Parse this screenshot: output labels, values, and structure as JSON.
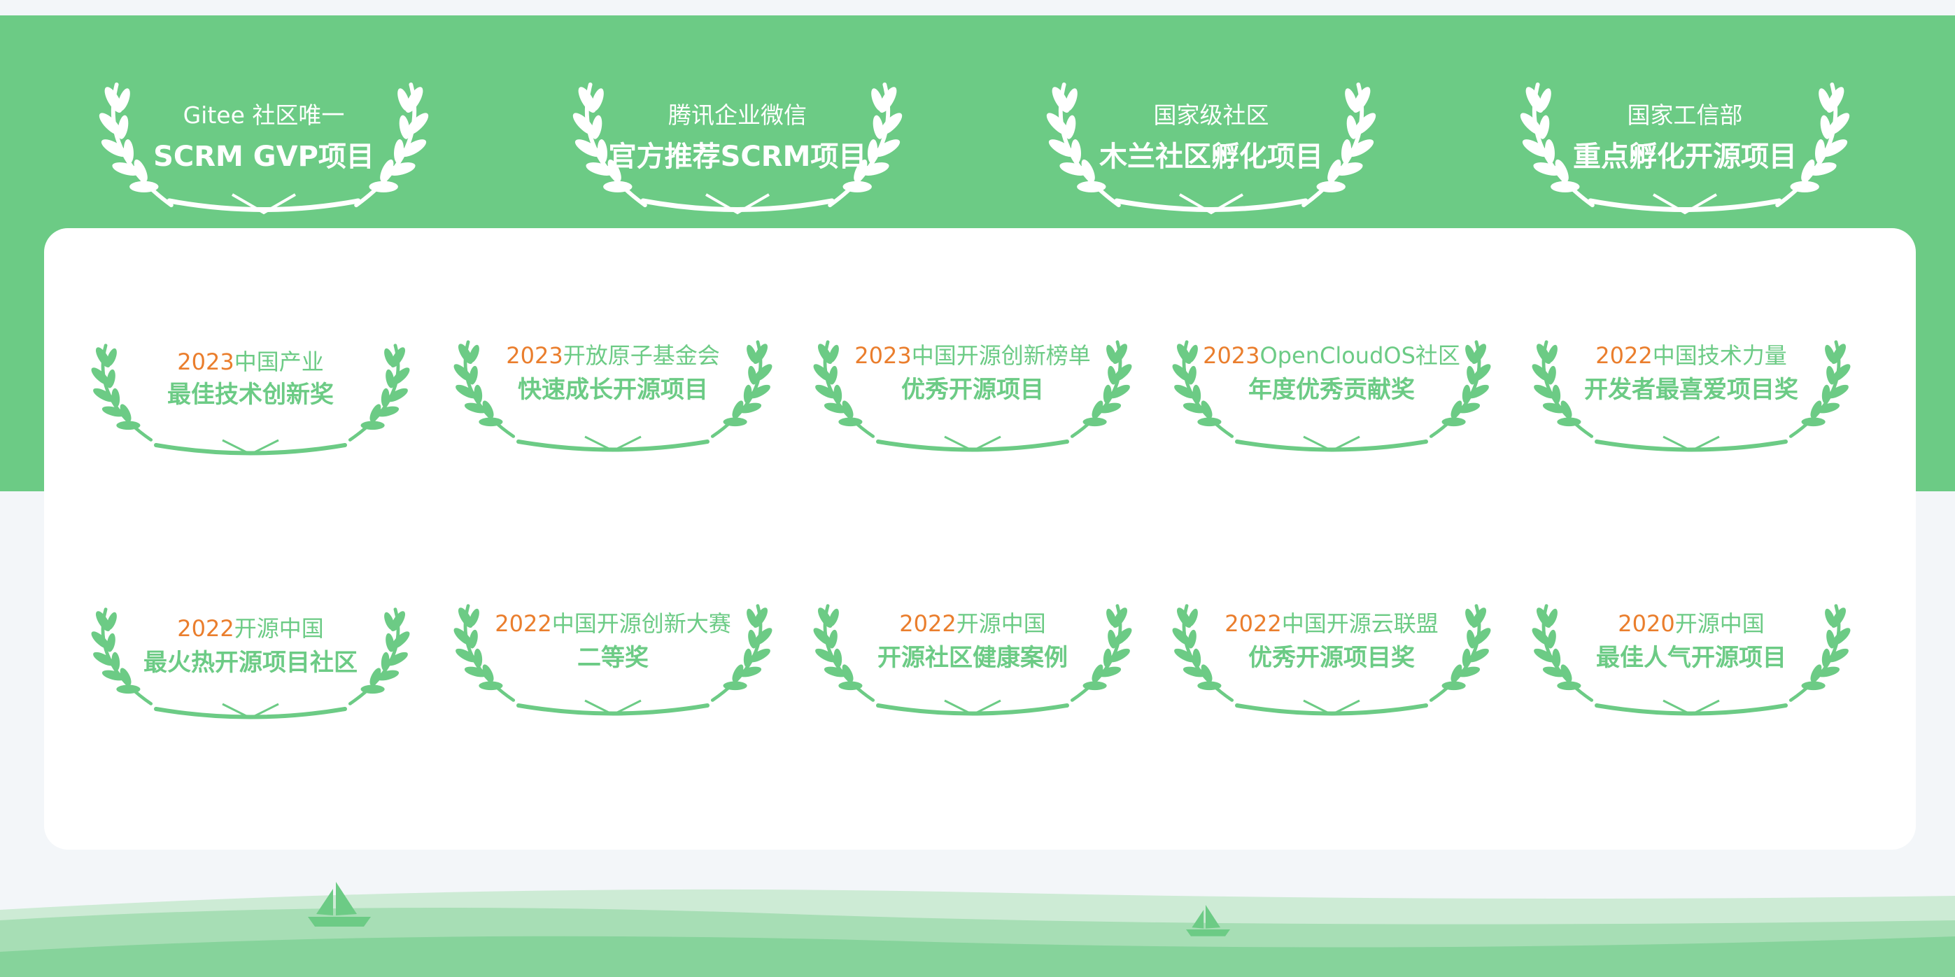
{
  "colors": {
    "green": "#6ccb85",
    "orange": "#ea7e2d",
    "white": "#ffffff",
    "page_bg": "#f3f6f9"
  },
  "icons": {
    "wreath": "laurel-wreath-icon",
    "boat": "sailboat-icon"
  },
  "hero_awards": [
    {
      "line1": "Gitee 社区唯一",
      "line2": "SCRM GVP项目"
    },
    {
      "line1": "腾讯企业微信",
      "line2": "官方推荐SCRM项目"
    },
    {
      "line1": "国家级社区",
      "line2": "木兰社区孵化项目"
    },
    {
      "line1": "国家工信部",
      "line2": "重点孵化开源项目"
    }
  ],
  "awards": [
    {
      "year": "2023",
      "org": "中国产业",
      "title": "最佳技术创新奖"
    },
    {
      "year": "2023",
      "org": "开放原子基金会",
      "title": "快速成长开源项目"
    },
    {
      "year": "2023",
      "org": "中国开源创新榜单",
      "title": "优秀开源项目"
    },
    {
      "year": "2023",
      "org": "OpenCloudOS社区",
      "title": "年度优秀贡献奖"
    },
    {
      "year": "2022",
      "org": "中国技术力量",
      "title": "开发者最喜爱项目奖"
    },
    {
      "year": "2022",
      "org": "开源中国",
      "title": "最火热开源项目社区"
    },
    {
      "year": "2022",
      "org": "中国开源创新大赛",
      "title": "二等奖"
    },
    {
      "year": "2022",
      "org": "开源中国",
      "title": "开源社区健康案例"
    },
    {
      "year": "2022",
      "org": "中国开源云联盟",
      "title": "优秀开源项目奖"
    },
    {
      "year": "2020",
      "org": "开源中国",
      "title": "最佳人气开源项目"
    }
  ]
}
